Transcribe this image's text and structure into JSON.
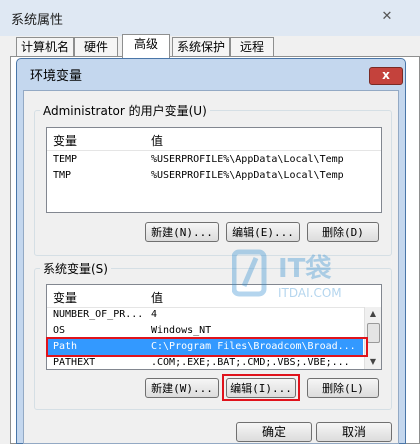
{
  "outer": {
    "title": "系统属性",
    "close": "✕",
    "tabs": [
      {
        "label": "计算机名"
      },
      {
        "label": "硬件"
      },
      {
        "label": "高级"
      },
      {
        "label": "系统保护"
      },
      {
        "label": "远程"
      }
    ]
  },
  "dialog": {
    "title": "环境变量",
    "close": "x",
    "user_group": {
      "label": "Administrator 的用户变量(U)",
      "col_var": "变量",
      "col_val": "值",
      "rows": [
        {
          "var": "TEMP",
          "val": "%USERPROFILE%\\AppData\\Local\\Temp"
        },
        {
          "var": "TMP",
          "val": "%USERPROFILE%\\AppData\\Local\\Temp"
        }
      ],
      "btn_new": "新建(N)...",
      "btn_edit": "编辑(E)...",
      "btn_delete": "删除(D)"
    },
    "system_group": {
      "label": "系统变量(S)",
      "col_var": "变量",
      "col_val": "值",
      "rows": [
        {
          "var": "NUMBER_OF_PR...",
          "val": "4"
        },
        {
          "var": "OS",
          "val": "Windows_NT"
        },
        {
          "var": "Path",
          "val": "C:\\Program Files\\Broadcom\\Broad..."
        },
        {
          "var": "PATHEXT",
          "val": ".COM;.EXE;.BAT;.CMD;.VBS;.VBE;..."
        }
      ],
      "btn_new": "新建(W)...",
      "btn_edit": "编辑(I)...",
      "btn_delete": "删除(L)"
    },
    "ok": "确定",
    "cancel": "取消"
  },
  "watermark": {
    "text": "ITDAI.COM",
    "logo_text": "IT袋"
  },
  "colors": {
    "selection": "#3399ff",
    "highlight_box": "#e0131c",
    "dialog_frame": "#c4d7ee"
  }
}
